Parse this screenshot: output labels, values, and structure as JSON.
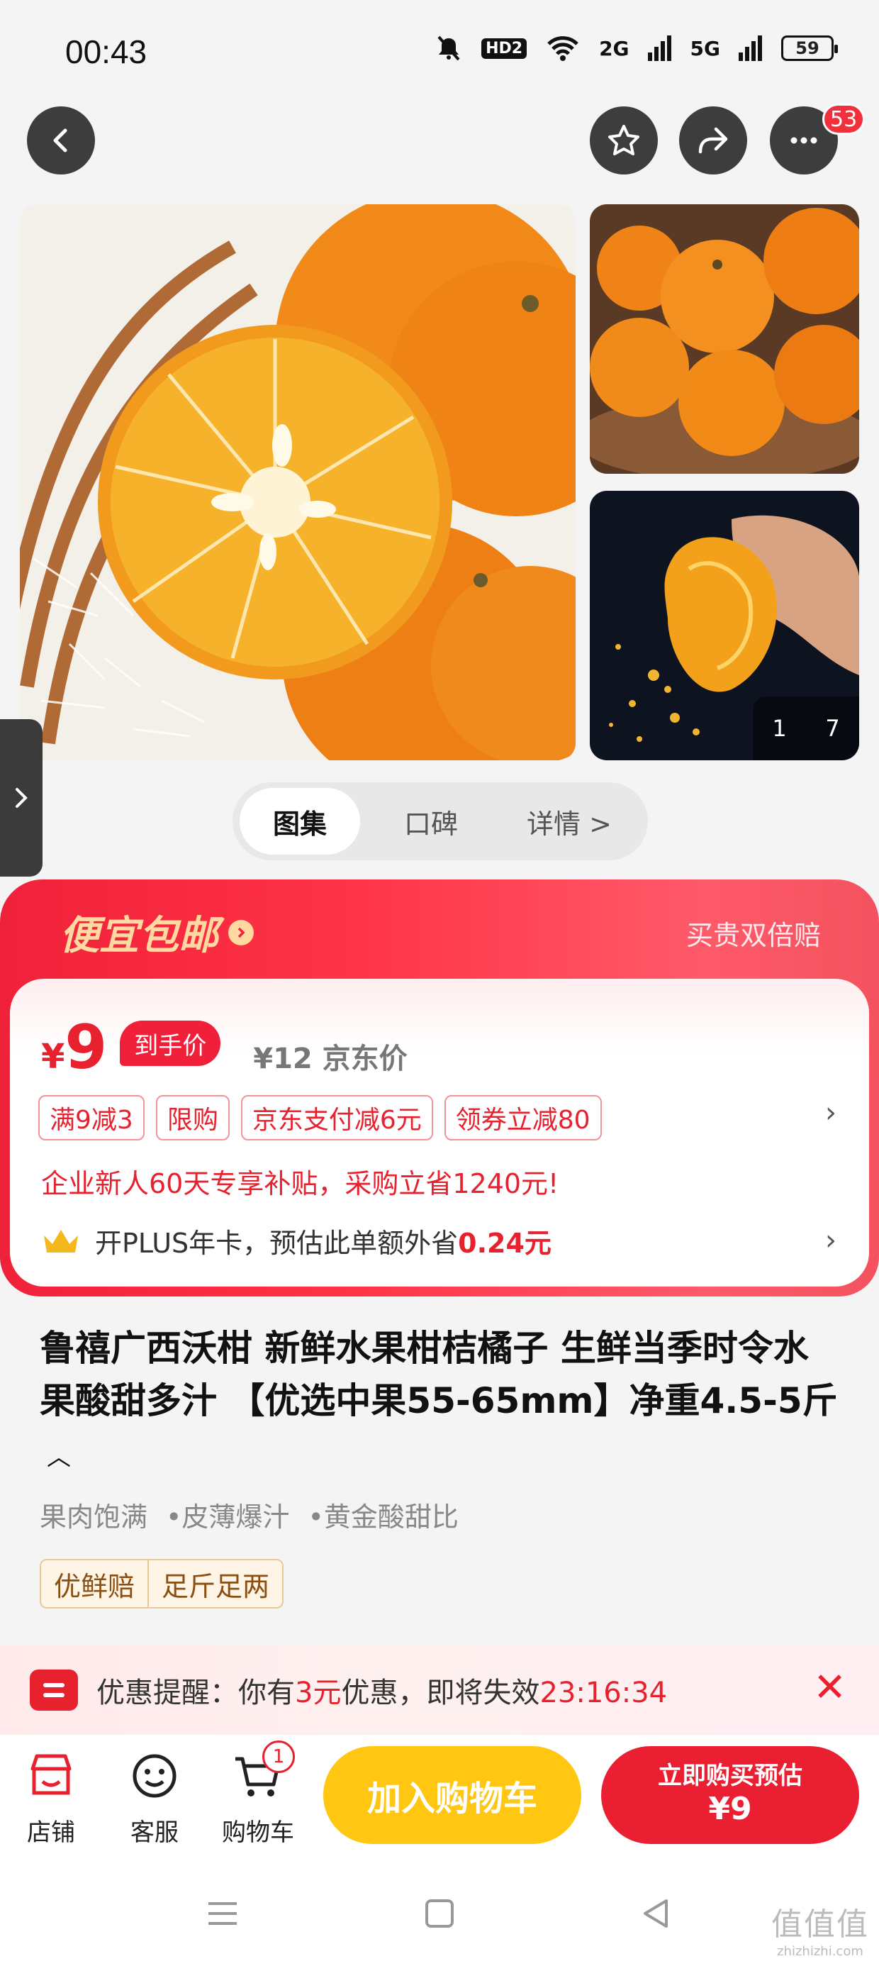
{
  "status_bar": {
    "time": "00:43",
    "hd": "HD2",
    "net1": "2G",
    "net2": "5G",
    "battery": "59"
  },
  "nav": {
    "menu_badge": "53"
  },
  "gallery": {
    "counter_current": "1",
    "counter_total": "7"
  },
  "tabs": [
    {
      "label": "图集"
    },
    {
      "label": "口碑"
    },
    {
      "label": "详情 >"
    }
  ],
  "promo": {
    "title": "便宜包邮",
    "guarantee": "买贵双倍赔",
    "currency": "¥",
    "price": "9",
    "price_tag": "到手价",
    "jd_price": "¥12 京东价",
    "coupons": [
      {
        "label": "满9减3"
      },
      {
        "label": "限购"
      },
      {
        "label": "京东支付减6元"
      },
      {
        "label": "领券立减80"
      }
    ],
    "corp_subsidy": "企业新人60天专享补贴，采购立省1240元!",
    "plus_text": "开PLUS年卡，预估此单额外省",
    "plus_amount": "0.24元"
  },
  "product": {
    "title": "鲁禧广西沃柑 新鲜水果柑桔橘子 生鲜当季时令水果酸甜多汁 【优选中果55-65mm】净重4.5-5斤",
    "features": [
      {
        "label": "果肉饱满"
      },
      {
        "label": "•皮薄爆汁"
      },
      {
        "label": "•黄金酸甜比"
      }
    ],
    "tags": [
      {
        "label": "优鲜赔"
      },
      {
        "label": "足斤足两"
      }
    ]
  },
  "reminder": {
    "prefix": "优惠提醒：你有",
    "count": "3元",
    "middle": "优惠，即将失效",
    "countdown": "23:16:34"
  },
  "bottom_bar": {
    "shop": "店铺",
    "service": "客服",
    "cart": "购物车",
    "cart_count": "1",
    "add_to_cart": "加入购物车",
    "buy_line1": "立即购买预估",
    "buy_line2": "¥9"
  },
  "watermark": {
    "main": "值值值",
    "sub": "zhizhizhi.com"
  }
}
